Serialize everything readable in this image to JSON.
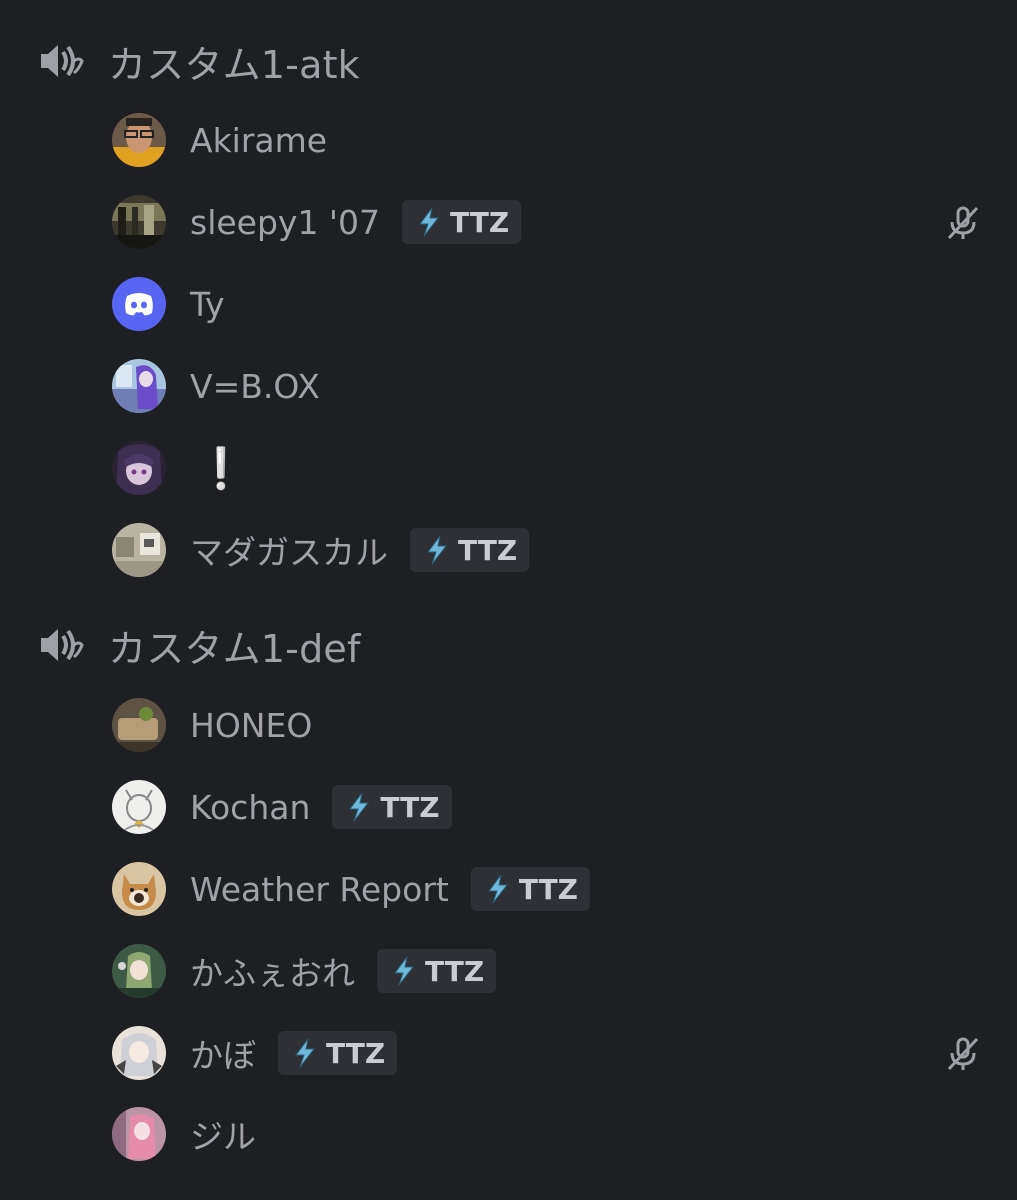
{
  "channels": [
    {
      "name": "カスタム1-atk",
      "icon": "voice-channel-icon",
      "members": [
        {
          "name": "Akirame",
          "avatar": "photo-face",
          "tag": null,
          "muted": false
        },
        {
          "name": "sleepy1 '07",
          "avatar": "photo-dark-room",
          "tag": "TTZ",
          "muted": true
        },
        {
          "name": "Ty",
          "avatar": "discord-default",
          "tag": null,
          "muted": false
        },
        {
          "name": "V=B.OX",
          "avatar": "anime-purple",
          "tag": null,
          "muted": false
        },
        {
          "name": "❕",
          "avatar": "anime-dark-purple",
          "tag": null,
          "muted": false
        },
        {
          "name": "マダガスカル",
          "avatar": "photo-room",
          "tag": "TTZ",
          "muted": false
        }
      ]
    },
    {
      "name": "カスタム1-def",
      "icon": "voice-channel-icon",
      "members": [
        {
          "name": "HONEO",
          "avatar": "photo-hand",
          "tag": null,
          "muted": false
        },
        {
          "name": "Kochan",
          "avatar": "sketch-character",
          "tag": "TTZ",
          "muted": false
        },
        {
          "name": "Weather Report",
          "avatar": "cat-photo",
          "tag": "TTZ",
          "muted": false
        },
        {
          "name": "かふぇおれ",
          "avatar": "anime-green",
          "tag": "TTZ",
          "muted": false
        },
        {
          "name": "かぼ",
          "avatar": "anime-white-hair",
          "tag": "TTZ",
          "muted": true
        },
        {
          "name": "ジル",
          "avatar": "anime-pink",
          "tag": null,
          "muted": false
        }
      ]
    }
  ],
  "colors": {
    "background": "#1e1f23",
    "text": "#a0a2a8",
    "tag_bg": "#2e3036",
    "discord_blurple": "#5865f2",
    "lightning": "#6fb8d9"
  }
}
